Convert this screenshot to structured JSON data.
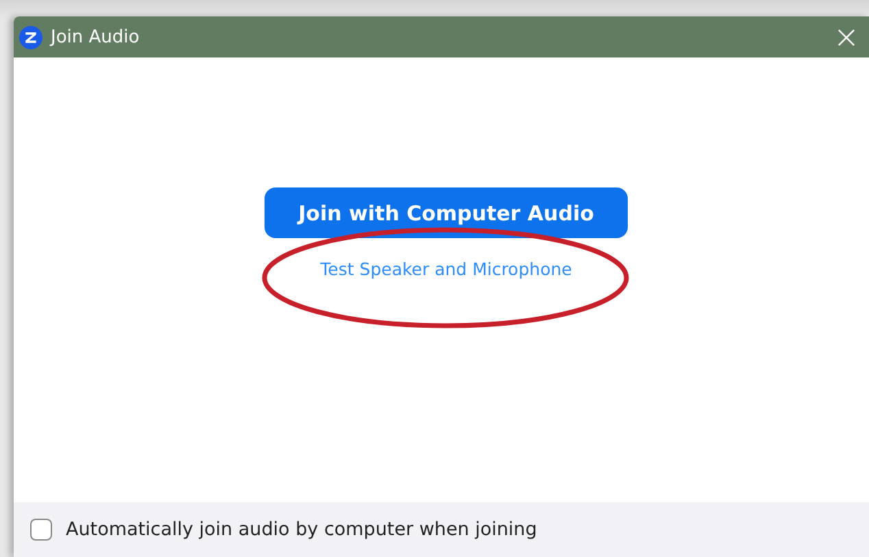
{
  "window": {
    "title": "Join Audio"
  },
  "primary_button": {
    "label": "Join with Computer Audio"
  },
  "link": {
    "label": "Test Speaker and Microphone"
  },
  "footer": {
    "checkbox": {
      "label": "Automatically join audio by computer when joining",
      "checked": false
    }
  }
}
